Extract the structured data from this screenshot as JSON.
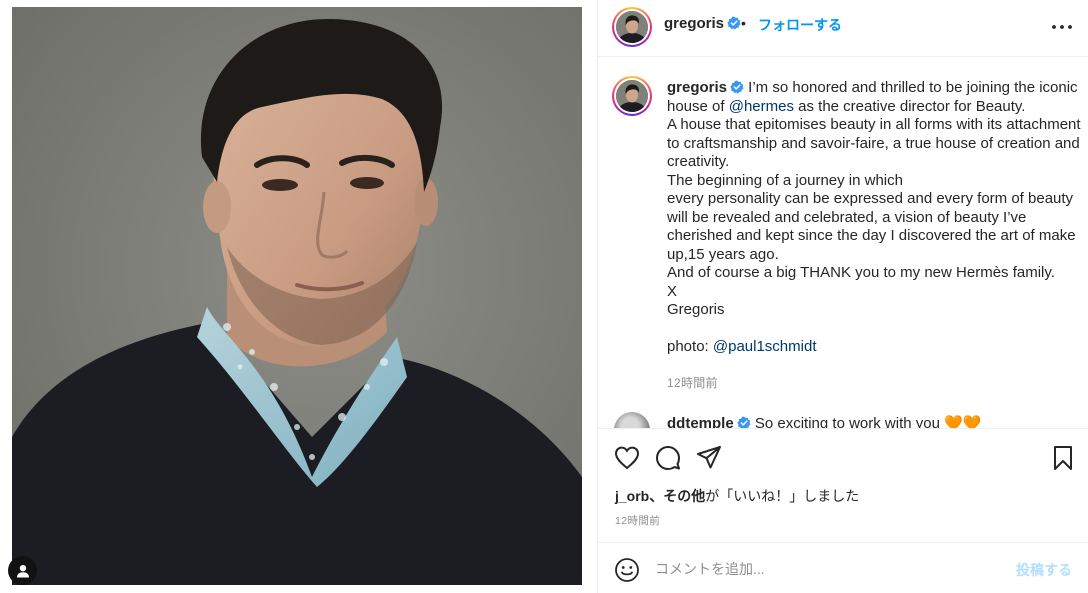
{
  "post": {
    "username": "gregoris",
    "verified": true,
    "separator": "•",
    "follow_label": "フォローする",
    "more_icon": "more-horizontal-icon"
  },
  "caption": {
    "username": "gregoris",
    "part1": " I’m so honored and thrilled to be joining the iconic house of ",
    "mention_hermes": "@hermes",
    "part2": " as the creative director for Beauty.",
    "line2": "A house that epitomises beauty in all forms with its attachment to craftsmanship and savoir-faire, a true house of creation and creativity.",
    "line3": "The beginning of a journey in which",
    "line4": "every personality can be expressed and every form of beauty will be revealed and celebrated, a vision of beauty I’ve cherished and kept since the day I discovered the art of make up,15 years ago.",
    "line5": "And of course a big THANK you to my new Hermès family.",
    "line6": "X",
    "line7": "Gregoris",
    "photo_label": "photo: ",
    "photo_mention": "@paul1schmidt",
    "time": "12時間前"
  },
  "next_comment": {
    "username": "ddtemple",
    "text": "So exciting to work with you 🧡🧡"
  },
  "actions": {
    "like_icon": "heart-icon",
    "comment_icon": "comment-icon",
    "share_icon": "paper-plane-icon",
    "save_icon": "bookmark-icon"
  },
  "likes": {
    "users": "j_orb、その他",
    "suffix": "が「いいね！」しました"
  },
  "post_time": "12時間前",
  "comment_box": {
    "placeholder": "コメントを追加...",
    "post_label": "投稿する"
  },
  "colors": {
    "accent_blue": "#0095f6",
    "link_blue": "#00376b",
    "post_disabled": "#b2dffc",
    "secondary_text": "#8e8e8e"
  }
}
